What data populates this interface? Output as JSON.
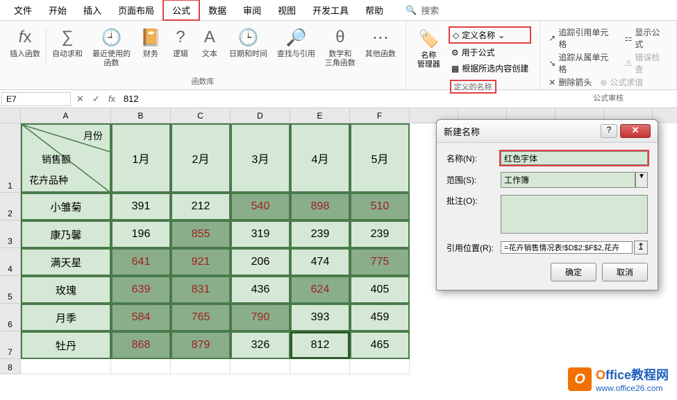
{
  "tabs": {
    "file": "文件",
    "home": "开始",
    "insert": "插入",
    "layout": "页面布局",
    "formula": "公式",
    "data": "数据",
    "review": "审阅",
    "view": "视图",
    "dev": "开发工具",
    "help": "帮助"
  },
  "search": {
    "label": "搜索"
  },
  "ribbon": {
    "fx": "插入函数",
    "autosum": "自动求和",
    "recent": "最近使用的\n函数",
    "financial": "财务",
    "logical": "逻辑",
    "text": "文本",
    "datetime": "日期和时间",
    "lookup": "查找与引用",
    "math": "数学和\n三角函数",
    "more": "其他函数",
    "lib_label": "函数库",
    "name_mgr": "名称\n管理器",
    "def_name": "定义名称",
    "use_formula": "用于公式",
    "from_sel": "根据所选内容创建",
    "names_label": "定义的名称",
    "trace_prec": "追踪引用单元格",
    "show_formula": "显示公式",
    "trace_dep": "追踪从属单元格",
    "err_check": "错误检查",
    "remove_arrow": "删除箭头",
    "eval": "公式求值",
    "audit_label": "公式审核"
  },
  "namebox": "E7",
  "formula_value": "812",
  "cols": {
    "A": "A",
    "B": "B",
    "C": "C",
    "D": "D",
    "E": "E",
    "F": "F"
  },
  "header": {
    "month": "月份",
    "sales": "销售额",
    "variety": "花卉品种"
  },
  "months": [
    "1月",
    "2月",
    "3月",
    "4月",
    "5月"
  ],
  "rows": [
    {
      "name": "小雏菊",
      "vals": [
        {
          "v": "391",
          "s": "g"
        },
        {
          "v": "212",
          "s": "g"
        },
        {
          "v": "540",
          "s": "d"
        },
        {
          "v": "898",
          "s": "d"
        },
        {
          "v": "510",
          "s": "d"
        }
      ]
    },
    {
      "name": "康乃馨",
      "vals": [
        {
          "v": "196",
          "s": "g"
        },
        {
          "v": "855",
          "s": "d"
        },
        {
          "v": "319",
          "s": "g"
        },
        {
          "v": "239",
          "s": "g"
        },
        {
          "v": "239",
          "s": "g"
        }
      ]
    },
    {
      "name": "满天星",
      "vals": [
        {
          "v": "641",
          "s": "d"
        },
        {
          "v": "921",
          "s": "d"
        },
        {
          "v": "206",
          "s": "g"
        },
        {
          "v": "474",
          "s": "g"
        },
        {
          "v": "775",
          "s": "d"
        }
      ]
    },
    {
      "name": "玫瑰",
      "vals": [
        {
          "v": "639",
          "s": "d"
        },
        {
          "v": "831",
          "s": "d"
        },
        {
          "v": "436",
          "s": "g"
        },
        {
          "v": "624",
          "s": "d"
        },
        {
          "v": "405",
          "s": "g"
        }
      ]
    },
    {
      "name": "月季",
      "vals": [
        {
          "v": "584",
          "s": "d"
        },
        {
          "v": "765",
          "s": "d"
        },
        {
          "v": "790",
          "s": "d"
        },
        {
          "v": "393",
          "s": "g"
        },
        {
          "v": "459",
          "s": "g"
        }
      ]
    },
    {
      "name": "牡丹",
      "vals": [
        {
          "v": "868",
          "s": "d"
        },
        {
          "v": "879",
          "s": "d"
        },
        {
          "v": "326",
          "s": "g"
        },
        {
          "v": "812",
          "s": "g",
          "sel": true
        },
        {
          "v": "465",
          "s": "g"
        }
      ]
    }
  ],
  "dialog": {
    "title": "新建名称",
    "name_label": "名称(N):",
    "name_value": "红色字体",
    "scope_label": "范围(S):",
    "scope_value": "工作簿",
    "comment_label": "批注(O):",
    "ref_label": "引用位置(R):",
    "ref_value": "=花卉销售情况表!$D$2:$F$2,花卉",
    "ok": "确定",
    "cancel": "取消"
  },
  "watermark": {
    "brand_o": "O",
    "brand_rest": "ffice教程网",
    "url": "www.office26.com"
  }
}
